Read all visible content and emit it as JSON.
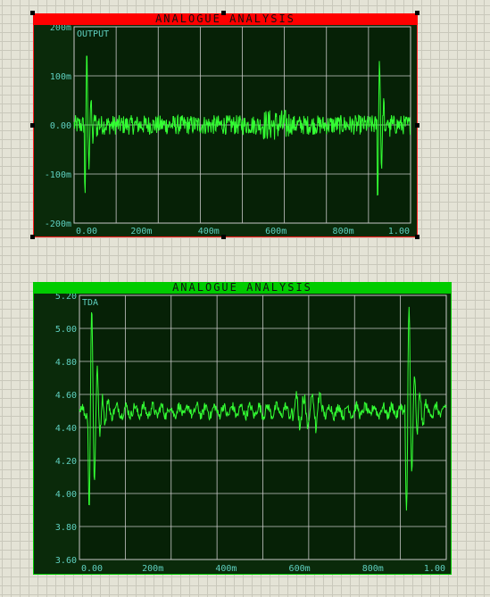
{
  "graphs": [
    {
      "title": "ANALOGUE ANALYSIS",
      "title_color": "#ff0000",
      "selected": true,
      "trace": "OUTPUT",
      "y_ticks": [
        "200m",
        "100m",
        "0.00",
        "-100m",
        "-200m"
      ],
      "x_ticks": [
        "0.00",
        "200m",
        "400m",
        "600m",
        "800m",
        "1.00"
      ],
      "ylim": [
        -200,
        200
      ],
      "xlim": [
        0,
        1
      ]
    },
    {
      "title": "ANALOGUE ANALYSIS",
      "title_color": "#00cc00",
      "selected": false,
      "trace": "TDA",
      "y_ticks": [
        "5.20",
        "5.00",
        "4.80",
        "4.60",
        "4.40",
        "4.20",
        "4.00",
        "3.80",
        "3.60"
      ],
      "x_ticks": [
        "0.00",
        "200m",
        "400m",
        "600m",
        "800m",
        "1.00"
      ],
      "ylim": [
        3.6,
        5.2
      ],
      "xlim": [
        0,
        1
      ]
    }
  ],
  "colors": {
    "plot_bg": "#062106",
    "panel_bg": "#0a2a0a",
    "grid": "#c8c8c8",
    "trace": "#33ff33",
    "axis_text": "#5fd0c0",
    "border_selected": "#ff2020",
    "border_normal": "#00cc00"
  }
}
